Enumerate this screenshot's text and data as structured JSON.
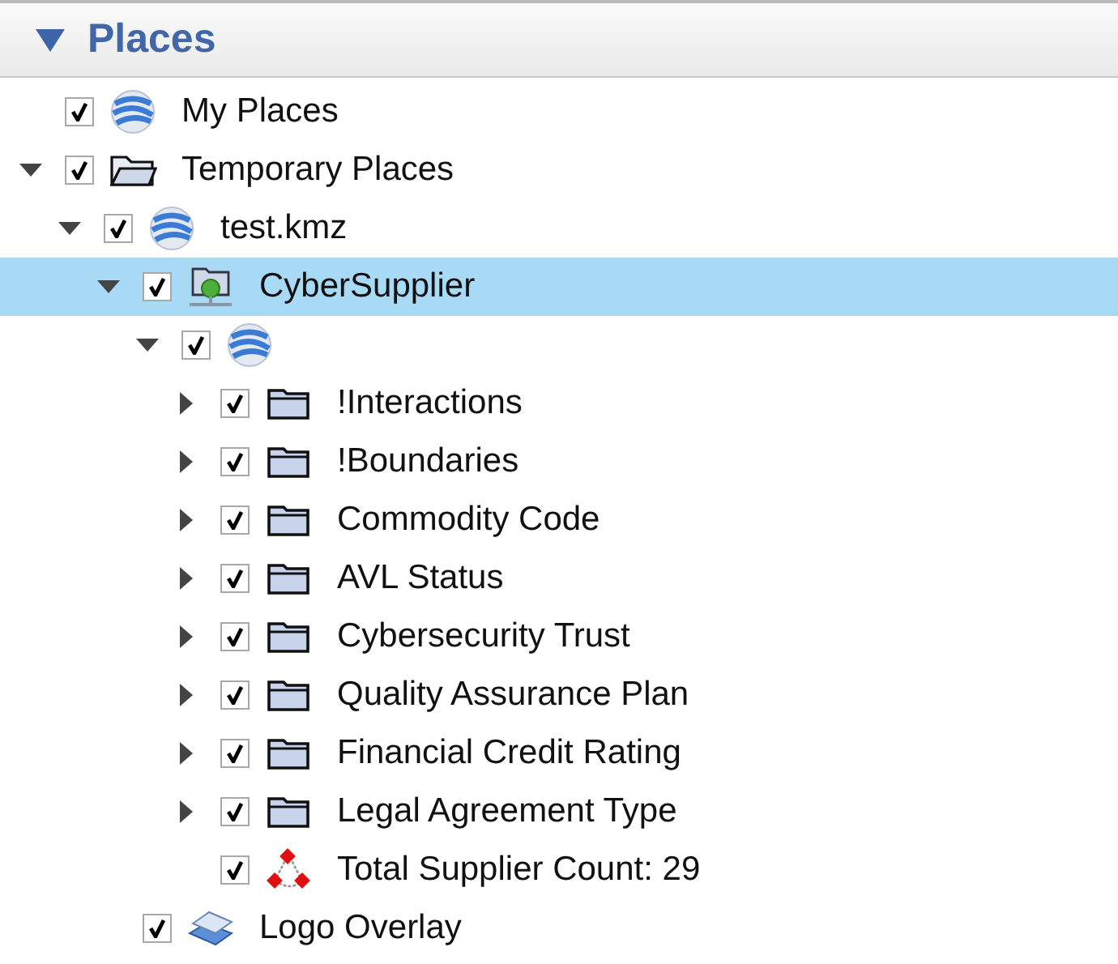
{
  "panel": {
    "title": "Places",
    "expanded": true
  },
  "tree": [
    {
      "label": "My Places",
      "kind": "globe",
      "checked": true,
      "selected": false
    },
    {
      "label": "Temporary Places",
      "kind": "folder-open",
      "checked": true,
      "selected": false,
      "expanded": true,
      "children": [
        {
          "label": "test.kmz",
          "kind": "globe",
          "checked": true,
          "selected": false,
          "expanded": true,
          "children": [
            {
              "label": "CyberSupplier",
              "kind": "network",
              "checked": true,
              "selected": true,
              "expanded": true,
              "children": [
                {
                  "kind": "globe",
                  "checked": true,
                  "selected": false,
                  "expanded": true,
                  "children": [
                    {
                      "label": "!Interactions",
                      "kind": "folder",
                      "checked": true,
                      "selected": false,
                      "expanded": false
                    },
                    {
                      "label": "!Boundaries",
                      "kind": "folder",
                      "checked": true,
                      "selected": false,
                      "expanded": false
                    },
                    {
                      "label": "Commodity Code",
                      "kind": "folder",
                      "checked": true,
                      "selected": false,
                      "expanded": false
                    },
                    {
                      "label": "AVL Status",
                      "kind": "folder",
                      "checked": true,
                      "selected": false,
                      "expanded": false
                    },
                    {
                      "label": "Cybersecurity Trust",
                      "kind": "folder",
                      "checked": true,
                      "selected": false,
                      "expanded": false
                    },
                    {
                      "label": "Quality Assurance Plan",
                      "kind": "folder",
                      "checked": true,
                      "selected": false,
                      "expanded": false
                    },
                    {
                      "label": "Financial Credit Rating",
                      "kind": "folder",
                      "checked": true,
                      "selected": false,
                      "expanded": false
                    },
                    {
                      "label": "Legal Agreement Type",
                      "kind": "folder",
                      "checked": true,
                      "selected": false,
                      "expanded": false
                    },
                    {
                      "label": "Total Supplier Count: 29",
                      "kind": "nodes",
                      "checked": true,
                      "selected": false
                    }
                  ]
                }
              ]
            },
            {
              "label": "Logo Overlay",
              "kind": "overlay",
              "checked": true,
              "selected": false
            }
          ]
        }
      ]
    }
  ]
}
